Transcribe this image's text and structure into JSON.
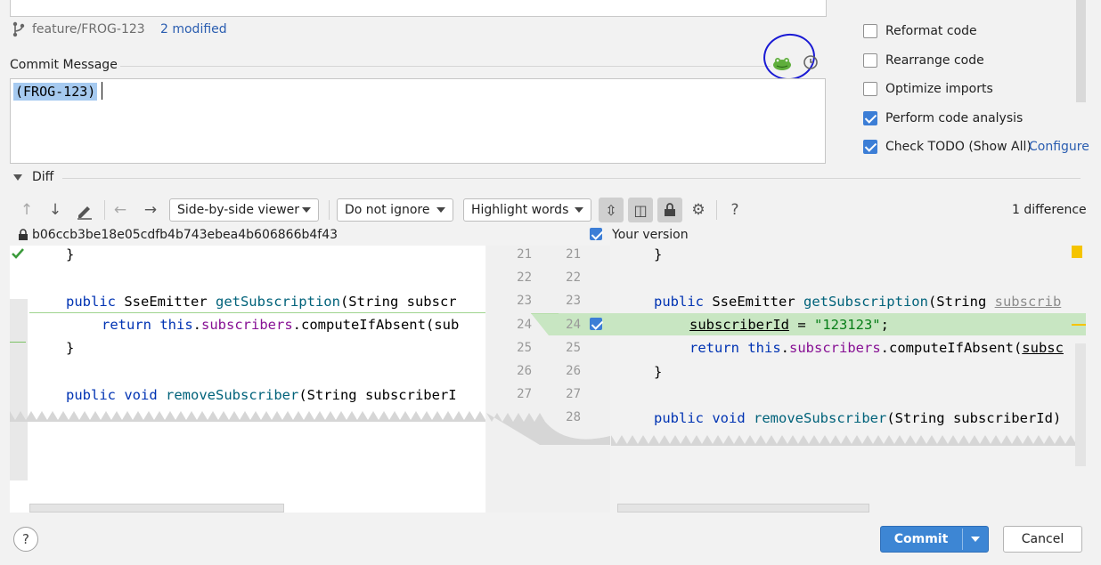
{
  "branch": {
    "name": "feature/FROG-123",
    "modified": "2 modified"
  },
  "commit_message": {
    "label": "Commit Message",
    "value": "(FROG-123)"
  },
  "before_commit": {
    "options": [
      {
        "label": "Reformat code",
        "checked": false
      },
      {
        "label": "Rearrange code",
        "checked": false
      },
      {
        "label": "Optimize imports",
        "checked": false
      },
      {
        "label": "Perform code analysis",
        "checked": true
      },
      {
        "label": "Check TODO (Show All)",
        "checked": true,
        "link": "Configure"
      }
    ]
  },
  "diff": {
    "label": "Diff",
    "viewer": "Side-by-side viewer",
    "ignore": "Do not ignore",
    "highlight": "Highlight words",
    "count": "1 difference",
    "left_hash": "b06ccb3be18e05cdfb4b743ebea4b606866b4f43",
    "right_label": "Your version",
    "left_numbers": [
      "21",
      "22",
      "23",
      "24",
      "25",
      "26",
      "27"
    ],
    "right_numbers": [
      "21",
      "22",
      "23",
      "24",
      "25",
      "26",
      "27",
      "28"
    ],
    "left_lines": {
      "l1": "}",
      "l3a": "public ",
      "l3b": "SseEmitter ",
      "l3c": "getSubscription",
      "l3d": "(String subscr",
      "l4a": "return ",
      "l4b": "this",
      "l4c": ".",
      "l4d": "subscribers",
      "l4e": ".computeIfAbsent(sub",
      "l5": "}",
      "l7a": "public ",
      "l7b": "void ",
      "l7c": "removeSubscriber",
      "l7d": "(String subscriberI"
    },
    "right_lines": {
      "r1": "}",
      "r3a": "public ",
      "r3b": "SseEmitter ",
      "r3c": "getSubscription",
      "r3d": "(String ",
      "r3e": "subscrib",
      "r4a": "subscriberId",
      "r4b": " = ",
      "r4c": "\"123123\"",
      "r4d": ";",
      "r5a": "return ",
      "r5b": "this",
      "r5c": ".",
      "r5d": "subscribers",
      "r5e": ".computeIfAbsent(",
      "r5f": "subsc",
      "r6": "}",
      "r8a": "public ",
      "r8b": "void ",
      "r8c": "removeSubscriber",
      "r8d": "(String subscriberId)"
    }
  },
  "footer": {
    "help": "?",
    "commit": "Commit",
    "cancel": "Cancel"
  },
  "toolbar": {
    "help": "?"
  }
}
